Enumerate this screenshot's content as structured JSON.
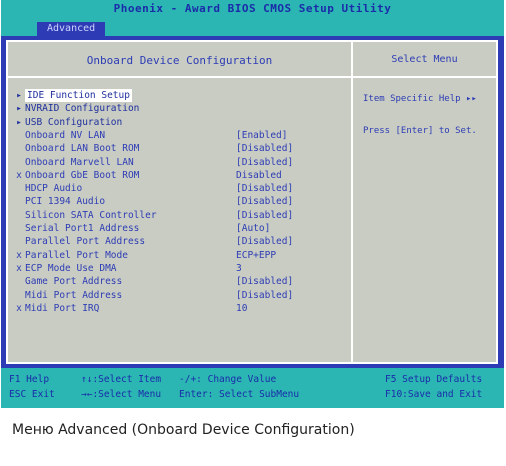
{
  "title": "Phoenix - Award BIOS CMOS Setup Utility",
  "tab": "Advanced",
  "section_title": "Onboard Device Configuration",
  "help": {
    "title": "Select Menu",
    "lines": [
      "Item Specific Help ▸▸",
      "Press [Enter] to Set."
    ]
  },
  "items": [
    {
      "mark": "▸",
      "label": "IDE Function Setup",
      "value": ""
    },
    {
      "mark": "▸",
      "label": "NVRAID Configuration",
      "value": ""
    },
    {
      "mark": "▸",
      "label": "USB Configuration",
      "value": ""
    },
    {
      "mark": "",
      "label": "Onboard NV LAN",
      "value": "[Enabled]"
    },
    {
      "mark": "",
      "label": "Onboard LAN Boot ROM",
      "value": "[Disabled]"
    },
    {
      "mark": "",
      "label": "Onboard Marvell LAN",
      "value": "[Disabled]"
    },
    {
      "mark": "x",
      "label": "Onboard GbE Boot ROM",
      "value": "Disabled"
    },
    {
      "mark": "",
      "label": "HDCP Audio",
      "value": "[Disabled]"
    },
    {
      "mark": "",
      "label": "PCI 1394 Audio",
      "value": "[Disabled]"
    },
    {
      "mark": "",
      "label": "Silicon SATA Controller",
      "value": "[Disabled]"
    },
    {
      "mark": "",
      "label": "Serial Port1 Address",
      "value": "[Auto]"
    },
    {
      "mark": "",
      "label": "Parallel Port Address",
      "value": "[Disabled]"
    },
    {
      "mark": "x",
      "label": "Parallel Port Mode",
      "value": "ECP+EPP"
    },
    {
      "mark": "x",
      "label": "ECP Mode Use DMA",
      "value": "3"
    },
    {
      "mark": "",
      "label": "Game Port Address",
      "value": "[Disabled]"
    },
    {
      "mark": "",
      "label": "Midi Port Address",
      "value": "[Disabled]"
    },
    {
      "mark": "x",
      "label": "Midi Port IRQ",
      "value": "10"
    }
  ],
  "footer": {
    "f1": "F1 Help",
    "nav_item": "↑↓:Select Item",
    "change": "-/+: Change Value",
    "defaults": "F5 Setup Defaults",
    "esc": "ESC Exit",
    "nav_menu": "→←:Select Menu",
    "enter": "Enter: Select SubMenu",
    "save": "F10:Save and Exit"
  },
  "caption": "Меню Advanced (Onboard Device Configuration)"
}
